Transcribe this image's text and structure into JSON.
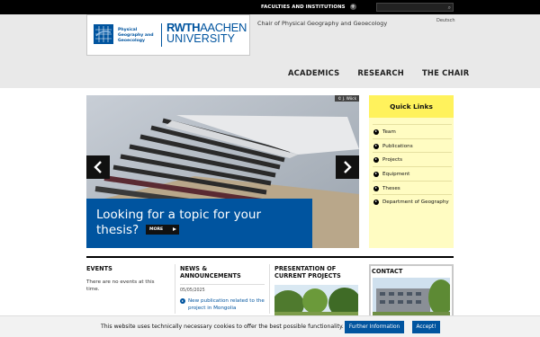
{
  "topbar": {
    "faculties_label": "FACULTIES AND INSTITUTIONS",
    "search_icon": "search-icon"
  },
  "header": {
    "logo_text": "Physical Geography and Geoecology",
    "university_line1_a": "RWTH",
    "university_line1_b": "AACHEN",
    "university_line2": "UNIVERSITY",
    "chair_name": "Chair of Physical Geography and Geoecology",
    "language_link": "Deutsch"
  },
  "nav": {
    "items": [
      {
        "label": "ACADEMICS"
      },
      {
        "label": "RESEARCH"
      },
      {
        "label": "THE CHAIR"
      }
    ]
  },
  "slider": {
    "credit": "© J. Wöck",
    "caption": "Looking for a topic for your thesis?",
    "more_label": "MORE"
  },
  "quick_links": {
    "title": "Quick Links",
    "items": [
      {
        "label": "Team"
      },
      {
        "label": "Publications"
      },
      {
        "label": "Projects"
      },
      {
        "label": "Equipment"
      },
      {
        "label": "Theses"
      },
      {
        "label": "Department of Geography"
      }
    ]
  },
  "events": {
    "title": "EVENTS",
    "text": "There are no events at this time."
  },
  "news": {
    "title": "NEWS & ANNOUNCEMENTS",
    "date": "05/05/2025",
    "link": "New publication related to the project in Mongolia"
  },
  "projects": {
    "title": "PRESENTATION OF CURRENT PROJECTS"
  },
  "contact": {
    "title": "CONTACT"
  },
  "cookie": {
    "text": "This website uses technically necessary cookies to offer the best possible functionality.",
    "info_button": "Further Information",
    "accept_button": "Accept!"
  },
  "colors": {
    "brand_blue": "#00549f",
    "quick_links_header": "#fff25c",
    "quick_links_bg": "#fffcc2",
    "topbar": "#000000"
  }
}
